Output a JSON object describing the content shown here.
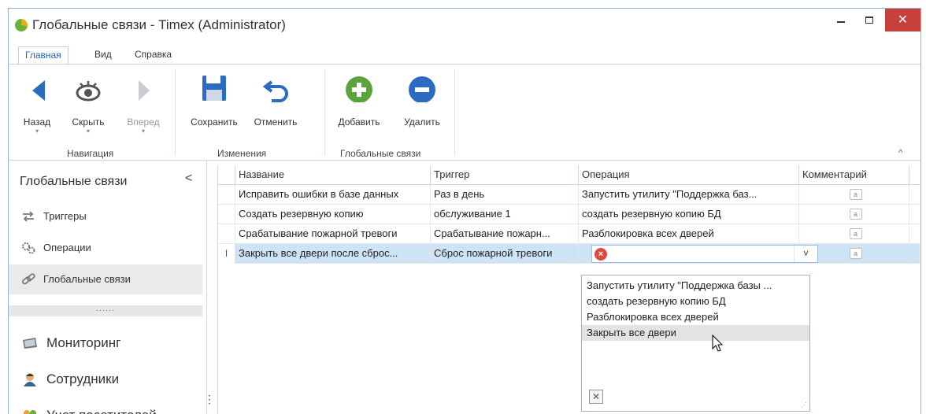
{
  "window": {
    "title": "Глобальные связи - Timex (Administrator)",
    "close_glyph": "✕",
    "accent": "#2465b3"
  },
  "tabs": [
    {
      "label": "Главная",
      "active": true
    },
    {
      "label": "Вид",
      "active": false
    },
    {
      "label": "Справка",
      "active": false
    }
  ],
  "ribbon": {
    "back": "Назад",
    "hide": "Скрыть",
    "forward": "Вперед",
    "save": "Сохранить",
    "undo": "Отменить",
    "add": "Добавить",
    "delete": "Удалить",
    "groups": {
      "navigation": "Навигация",
      "changes": "Изменения",
      "global_links": "Глобальные связи"
    },
    "collapse_glyph": "^"
  },
  "sidebar": {
    "title": "Глобальные связи",
    "collapse_glyph": "<",
    "items": [
      {
        "label": "Триггеры",
        "icon": "arrows-icon"
      },
      {
        "label": "Операции",
        "icon": "gears-icon"
      },
      {
        "label": "Глобальные связи",
        "icon": "chain-link-icon",
        "selected": true
      }
    ],
    "handle_glyph": "......",
    "modules": [
      {
        "label": "Мониторинг",
        "icon": "monitor-icon"
      },
      {
        "label": "Сотрудники",
        "icon": "employees-icon"
      },
      {
        "label": "Учет посетителей",
        "icon": "visitors-icon"
      }
    ],
    "more_glyph": "⋮"
  },
  "grid": {
    "columns": [
      "Название",
      "Триггер",
      "Операция",
      "Комментарий"
    ],
    "rows": [
      {
        "name": "Исправить ошибки в базе данных",
        "trigger": "Раз в день",
        "operation": "Запустить утилиту \"Поддержка баз..."
      },
      {
        "name": "Создать резервную копию",
        "trigger": "обслуживание 1",
        "operation": "создать резервную копию БД"
      },
      {
        "name": "Срабатывание пожарной тревоги",
        "trigger": "Срабатывание пожарн...",
        "operation": "Разблокировка всех дверей"
      },
      {
        "name": "Закрыть все двери после сброс...",
        "trigger": "Сброс пожарной тревоги",
        "operation": ""
      }
    ],
    "comment_glyph": "a",
    "row_marker": "I",
    "error_glyph": "×",
    "dropdown_glyph": "˅"
  },
  "dropdown": {
    "options": [
      "Запустить утилиту \"Поддержка базы ...",
      "создать резервную копию БД",
      "Разблокировка всех дверей",
      "Закрыть все двери"
    ],
    "highlighted": "Закрыть все двери",
    "clear_glyph": "✕",
    "grip_glyph": "⋰"
  }
}
